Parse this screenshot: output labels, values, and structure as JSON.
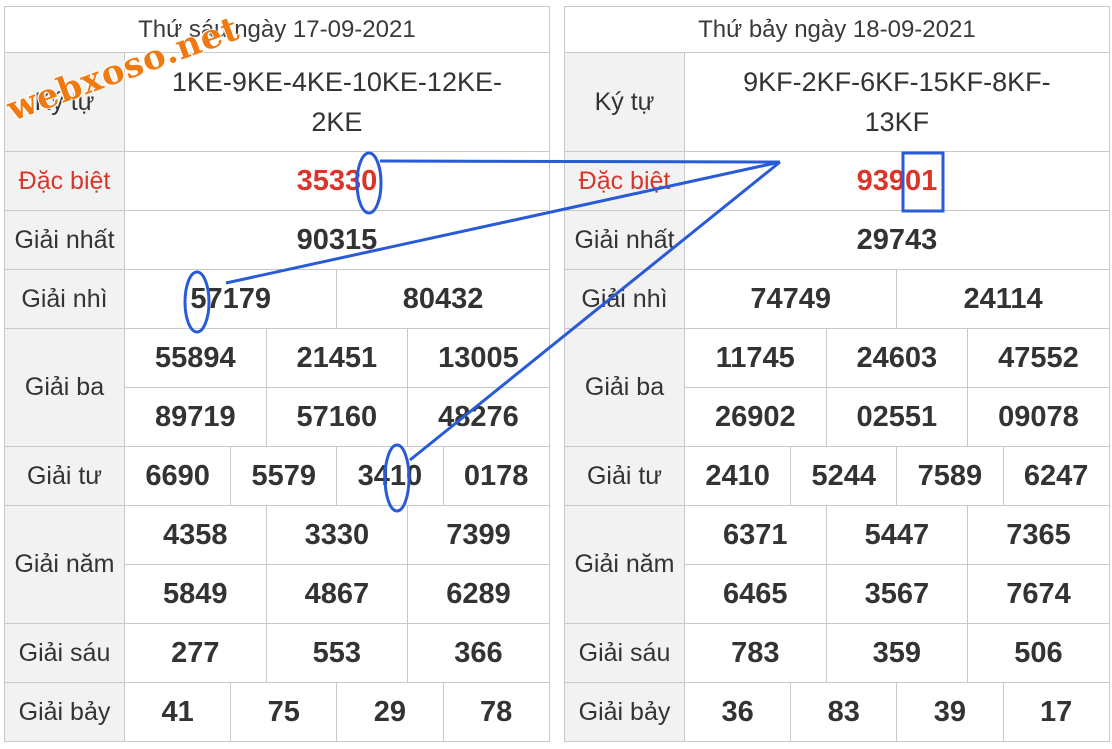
{
  "watermark": "webxoso.net",
  "colors": {
    "special_red": "#d9352a",
    "annotation_blue": "#2a5bd7",
    "label_bg": "#f2f2f2"
  },
  "left": {
    "header": "Thứ sáu ngày 17-09-2021",
    "ky_tu_label": "Ký tự",
    "ky_tu_line1": "1KE-9KE-4KE-10KE-12KE-",
    "ky_tu_line2": "2KE",
    "labels": {
      "db": "Đặc biệt",
      "g1": "Giải nhất",
      "g2": "Giải nhì",
      "g3": "Giải ba",
      "g4": "Giải tư",
      "g5": "Giải năm",
      "g6": "Giải sáu",
      "g7": "Giải bảy"
    },
    "db": "35330",
    "g1": "90315",
    "g2": [
      "57179",
      "80432"
    ],
    "g3": [
      "55894",
      "21451",
      "13005",
      "89719",
      "57160",
      "48276"
    ],
    "g4": [
      "6690",
      "5579",
      "3410",
      "0178"
    ],
    "g5": [
      "4358",
      "3330",
      "7399",
      "5849",
      "4867",
      "6289"
    ],
    "g6": [
      "277",
      "553",
      "366"
    ],
    "g7": [
      "41",
      "75",
      "29",
      "78"
    ]
  },
  "right": {
    "header": "Thứ bảy ngày 18-09-2021",
    "ky_tu_label": "Ký tự",
    "ky_tu_line1": "9KF-2KF-6KF-15KF-8KF-",
    "ky_tu_line2": "13KF",
    "labels": {
      "db": "Đặc biệt",
      "g1": "Giải nhất",
      "g2": "Giải nhì",
      "g3": "Giải ba",
      "g4": "Giải tư",
      "g5": "Giải năm",
      "g6": "Giải sáu",
      "g7": "Giải bảy"
    },
    "db": "93901",
    "g1": "29743",
    "g2": [
      "74749",
      "24114"
    ],
    "g3": [
      "11745",
      "24603",
      "47552",
      "26902",
      "02551",
      "09078"
    ],
    "g4": [
      "2410",
      "5244",
      "7589",
      "6247"
    ],
    "g5": [
      "6371",
      "5447",
      "7365",
      "6465",
      "3567",
      "7674"
    ],
    "g6": [
      "783",
      "359",
      "506"
    ],
    "g7": [
      "36",
      "83",
      "39",
      "17"
    ]
  }
}
